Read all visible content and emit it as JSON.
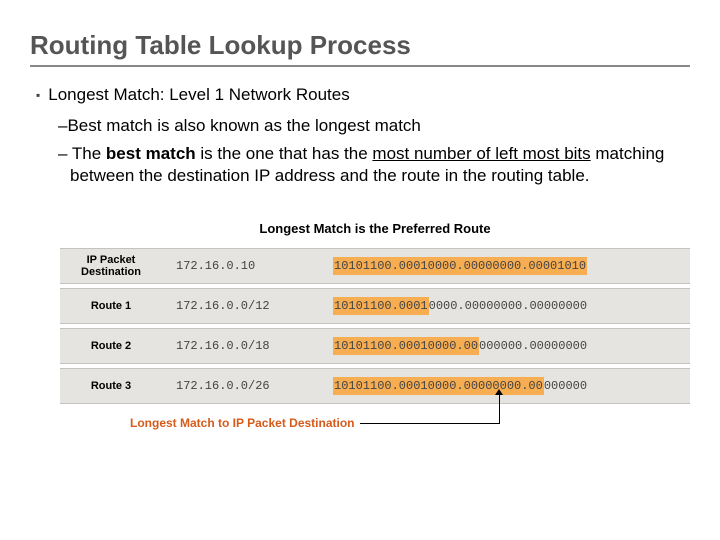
{
  "title": "Routing Table Lookup Process",
  "bullet1": "Longest Match: Level 1 Network Routes",
  "sub1": "Best match is also known as the longest match",
  "sub2a": "The ",
  "sub2b": "best match",
  "sub2c": " is the one that has the ",
  "sub2d": "most number of left most bits",
  "sub2e": " matching between the destination IP address and the route in the routing table.",
  "fig_title": "Longest Match is the Preferred Route",
  "rows": {
    "r0": {
      "label": "IP Packet Destination",
      "mid": "172.16.0.10",
      "hl": "10101100.00010000.00000000.00001010",
      "rest": ""
    },
    "r1": {
      "label": "Route 1",
      "mid": "172.16.0.0/12",
      "hl": "10101100.0001",
      "rest": "0000.00000000.00000000"
    },
    "r2": {
      "label": "Route 2",
      "mid": "172.16.0.0/18",
      "hl": "10101100.00010000.00",
      "rest": "000000.00000000"
    },
    "r3": {
      "label": "Route 3",
      "mid": "172.16.0.0/26",
      "hl": "10101100.00010000.00000000.00",
      "rest": "000000"
    }
  },
  "caption": "Longest Match to IP Packet Destination"
}
